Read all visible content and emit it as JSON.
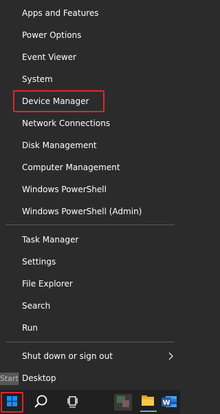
{
  "menu": {
    "items": [
      {
        "label": "Apps and Features"
      },
      {
        "label": "Power Options"
      },
      {
        "label": "Event Viewer"
      },
      {
        "label": "System"
      },
      {
        "label": "Device Manager"
      },
      {
        "label": "Network Connections"
      },
      {
        "label": "Disk Management"
      },
      {
        "label": "Computer Management"
      },
      {
        "label": "Windows PowerShell"
      },
      {
        "label": "Windows PowerShell (Admin)"
      },
      {
        "label": "Task Manager"
      },
      {
        "label": "Settings"
      },
      {
        "label": "File Explorer"
      },
      {
        "label": "Search"
      },
      {
        "label": "Run"
      },
      {
        "label": "Shut down or sign out"
      },
      {
        "label": "Desktop"
      }
    ],
    "highlighted_item": "Device Manager"
  },
  "tooltip": {
    "start_label": "Start"
  },
  "taskbar": {
    "icons": [
      "windows-start-icon",
      "search-icon",
      "task-view-icon",
      "app-icon",
      "file-explorer-icon",
      "word-icon"
    ],
    "word_letter": "W"
  },
  "colors": {
    "menu_bg": "#2b2b2b",
    "taskbar_bg": "#202020",
    "highlight": "#e3262c",
    "windows_blue": "#1a8cff",
    "word_blue": "#2b579a"
  }
}
